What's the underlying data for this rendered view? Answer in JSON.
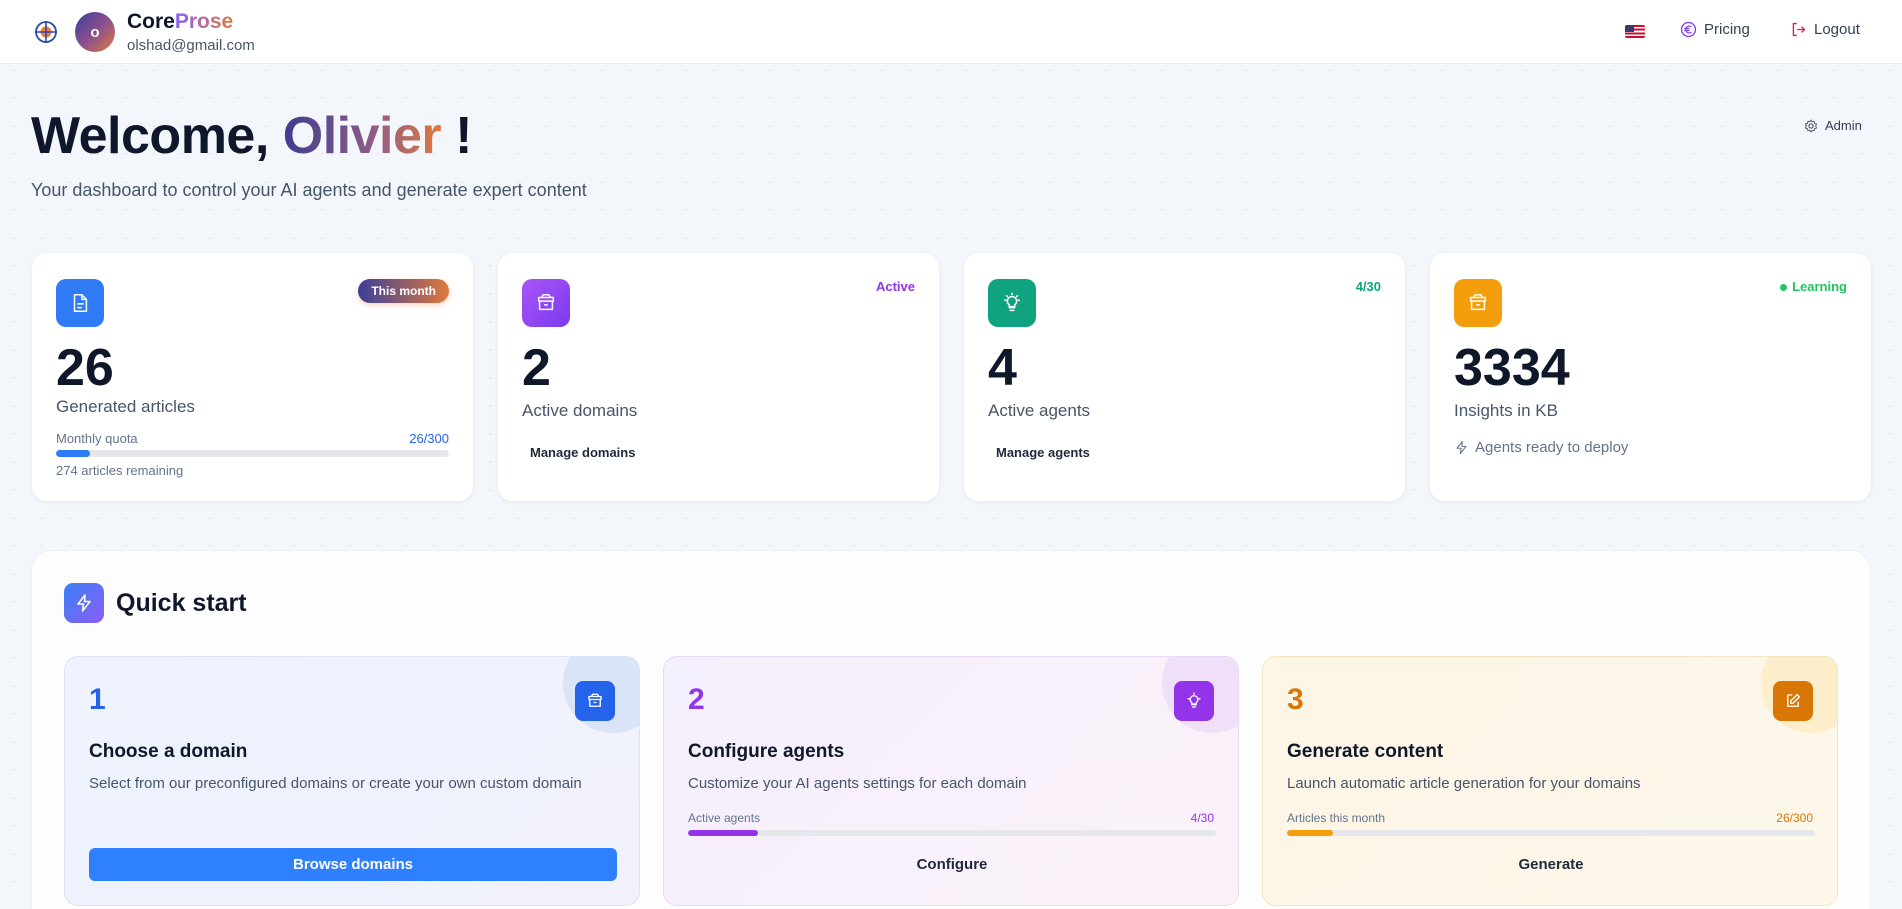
{
  "header": {
    "brand_part1": "Core",
    "brand_part2": "Prose",
    "avatar_initial": "o",
    "email": "olshad@gmail.com",
    "flag_icon": "us-flag-icon",
    "pricing_label": "Pricing",
    "logout_label": "Logout"
  },
  "welcome": {
    "greeting": "Welcome, ",
    "name": "Olivier",
    "suffix": " !",
    "subtitle": "Your dashboard to control your AI agents and generate expert content",
    "admin_label": "Admin"
  },
  "stats": {
    "articles": {
      "value": "26",
      "label": "Generated articles",
      "badge": "This month",
      "quota_label": "Monthly quota",
      "quota_value": "26/300",
      "quota_progress": 0.0867,
      "remaining": "274 articles remaining",
      "icon": "document-icon",
      "color": "#2f7bf5"
    },
    "domains": {
      "value": "2",
      "label": "Active domains",
      "badge": "Active",
      "link": "Manage domains",
      "icon": "archive-box-icon",
      "color": "#9333ea"
    },
    "agents": {
      "value": "4",
      "label": "Active agents",
      "badge": "4/30",
      "link": "Manage agents",
      "icon": "lightbulb-icon",
      "color": "#10a37f"
    },
    "insights": {
      "value": "3334",
      "label": "Insights in KB",
      "badge": "Learning",
      "note": "Agents ready to deploy",
      "icon": "archive-box-icon",
      "color": "#f59e0b"
    }
  },
  "quick_start": {
    "title": "Quick start",
    "steps": [
      {
        "number": "1",
        "title": "Choose a domain",
        "description": "Select from our preconfigured domains or create your own custom domain",
        "button": "Browse domains",
        "icon": "archive-box-icon",
        "color": "#2563eb"
      },
      {
        "number": "2",
        "title": "Configure agents",
        "description": "Customize your AI agents settings for each domain",
        "progress_label": "Active agents",
        "progress_value": "4/30",
        "progress": 0.1333,
        "button": "Configure",
        "icon": "lightbulb-icon",
        "color": "#9333ea"
      },
      {
        "number": "3",
        "title": "Generate content",
        "description": "Launch automatic article generation for your domains",
        "progress_label": "Articles this month",
        "progress_value": "26/300",
        "progress": 0.0867,
        "button": "Generate",
        "icon": "edit-icon",
        "color": "#d97706"
      }
    ]
  }
}
